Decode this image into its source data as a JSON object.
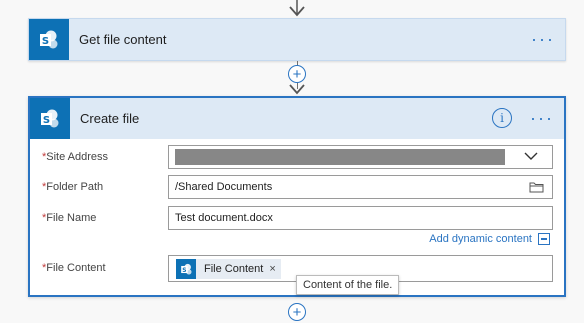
{
  "colors": {
    "accent": "#2a74c2",
    "sharepoint_tile": "#0d71b5",
    "header_bg": "#dde9f5",
    "required": "#c23a3a"
  },
  "step1": {
    "title": "Get file content",
    "menu": "···"
  },
  "connector": {
    "plus": "+"
  },
  "step2": {
    "title": "Create file",
    "info": "i",
    "menu": "···",
    "fields": [
      {
        "required_mark": "*",
        "label": "Site Address",
        "value": ""
      },
      {
        "required_mark": "*",
        "label": "Folder Path",
        "value": "/Shared Documents"
      },
      {
        "required_mark": "*",
        "label": "File Name",
        "value": "Test document.docx"
      },
      {
        "required_mark": "*",
        "label": "File Content",
        "value": ""
      }
    ],
    "add_dynamic_content": "Add dynamic content",
    "token": {
      "label": "File Content",
      "remove": "×"
    }
  },
  "tooltip": "Content of the file.",
  "icons": [
    "sharepoint-icon",
    "chevron-down-icon",
    "folder-icon",
    "info-icon",
    "dynamic-content-icon",
    "close-icon",
    "arrow-down-icon",
    "plus-icon"
  ]
}
